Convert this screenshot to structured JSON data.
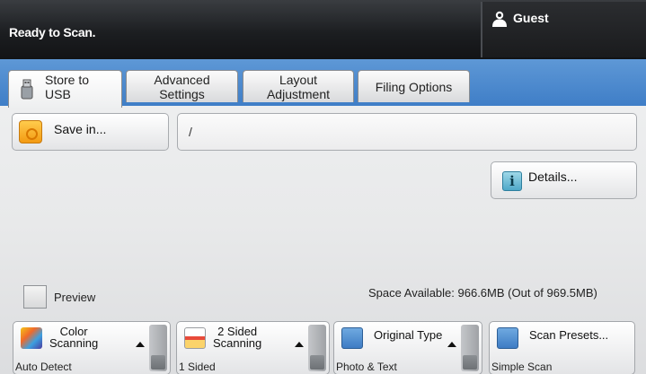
{
  "status": {
    "text": "Ready to Scan."
  },
  "user": {
    "label": "Guest",
    "icon": "user-icon"
  },
  "tabs": [
    {
      "label": "Store to USB",
      "line1": "Store to",
      "line2": "USB",
      "active": true,
      "icon": "usb-drive-icon"
    },
    {
      "label": "Advanced Settings",
      "line1": "Advanced",
      "line2": "Settings",
      "active": false
    },
    {
      "label": "Layout Adjustment",
      "line1": "Layout",
      "line2": "Adjustment",
      "active": false
    },
    {
      "label": "Filing Options",
      "active": false
    }
  ],
  "save_in": {
    "label": "Save in...",
    "icon": "folder-icon"
  },
  "path": {
    "value": "/"
  },
  "details": {
    "label": "Details...",
    "icon": "info-icon"
  },
  "preview": {
    "label": "Preview",
    "checked": false
  },
  "space": {
    "text": "Space Available: 966.6MB (Out of 969.5MB)"
  },
  "functions": [
    {
      "line1": "Color",
      "line2": "Scanning",
      "value": "Auto Detect",
      "icon": "color-scanning-icon"
    },
    {
      "line1": "2 Sided",
      "line2": "Scanning",
      "value": "1 Sided",
      "icon": "two-sided-icon"
    },
    {
      "line1": "Original Type",
      "line2": "",
      "value": "Photo & Text",
      "icon": "original-type-icon"
    },
    {
      "line1": "Scan Presets...",
      "line2": "",
      "value": "Simple Scan",
      "icon": "scan-presets-icon"
    }
  ],
  "colors": {
    "status_bar": "#1c1e21",
    "tab_strip": "#4a88cc",
    "panel": "#eceded"
  }
}
